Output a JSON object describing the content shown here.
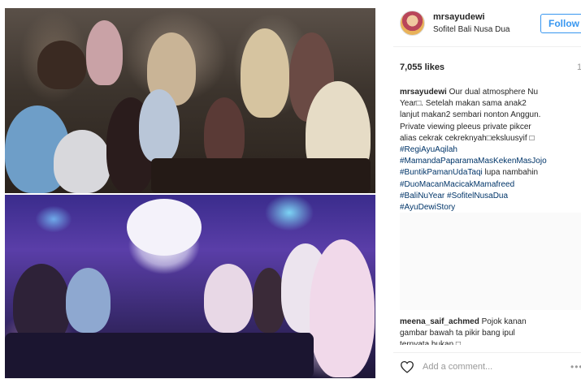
{
  "post": {
    "username": "mrsayudewi",
    "location": "Sofitel Bali Nusa Dua",
    "follow_label": "Follow",
    "likes": "7,055 likes",
    "likes_side": "1",
    "caption": {
      "user": "mrsayudewi",
      "lines": [
        " Our dual atmosphere Nu",
        "Year□. Setelah makan sama anak2",
        "lanjut makan2 sembari nonton Anggun.",
        "Private viewing pleeus private pikcer",
        "alias cekrak cekreknyah□eksluusyif □"
      ],
      "tags": [
        "#RegiAyuAqilah",
        "#MamandaPaparamaMasKekenMasJojo",
        "#BuntikPamanUdaTaqi",
        "#DuoMacanMacicakMamafreed",
        "#BaliNuYear",
        "#SofitelNusaDua",
        "#AyuDewiStory"
      ],
      "tag_suffix": " lupa nambahin"
    },
    "comment": {
      "user": "meena_saif_achmed",
      "line1": " Pojok kanan",
      "line2": "gambar bawah ta pikir bang ipul",
      "line3": "ternyata bukan □"
    },
    "add_comment_placeholder": "Add a comment...",
    "more_label": "•••"
  },
  "colors": {
    "accent": "#3897f0",
    "hashtag": "#003569",
    "text": "#262626",
    "muted": "#999999"
  },
  "icons": {
    "heart": "heart-icon",
    "more": "more-options-icon"
  }
}
